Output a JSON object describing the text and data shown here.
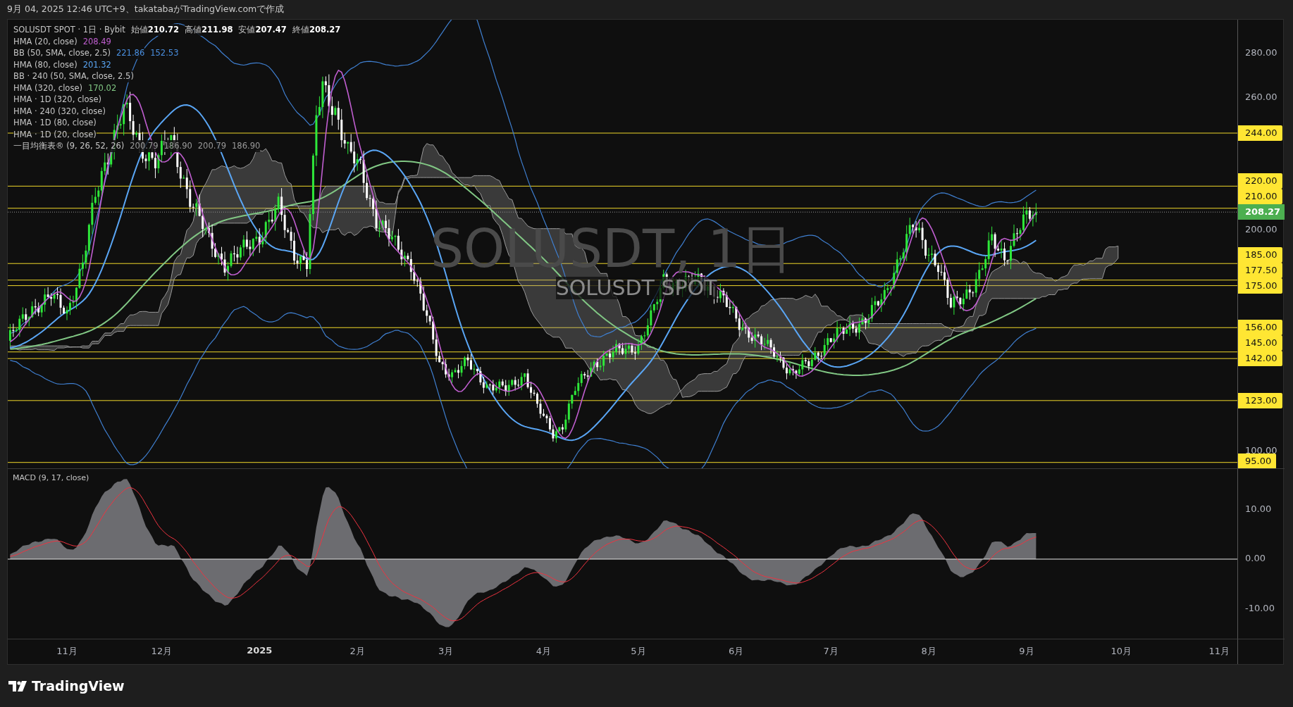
{
  "header": {
    "text": "9月 04, 2025 12:46 UTC+9、takatabaがTradingView.comで作成"
  },
  "legend": {
    "symbol": "SOLUSDT SPOT · 1日 · Bybit",
    "ohlc": [
      {
        "label": "始値",
        "value": "210.72"
      },
      {
        "label": "高値",
        "value": "211.98"
      },
      {
        "label": "安値",
        "value": "207.47"
      },
      {
        "label": "終値",
        "value": "208.27"
      }
    ],
    "indicators": [
      {
        "name": "HMA (20, close)",
        "values": [
          {
            "text": "208.49",
            "color": "#c05ed0"
          }
        ]
      },
      {
        "name": "BB (50, SMA, close, 2.5)",
        "values": [
          {
            "text": "221.86",
            "color": "#4a8fe0"
          },
          {
            "text": "152.53",
            "color": "#4a8fe0"
          }
        ]
      },
      {
        "name": "HMA (80, close)",
        "values": [
          {
            "text": "201.32",
            "color": "#5aa6f5"
          }
        ]
      },
      {
        "name": "BB · 240 (50, SMA, close, 2.5)"
      },
      {
        "name": "HMA (320, close)",
        "values": [
          {
            "text": "170.02",
            "color": "#81c784"
          }
        ]
      },
      {
        "name": "HMA · 1D (320, close)"
      },
      {
        "name": "HMA · 240 (320, close)"
      },
      {
        "name": "HMA · 1D (80, close)"
      },
      {
        "name": "HMA · 1D (20, close)"
      },
      {
        "name": "一目均衡表® (9, 26, 52, 26)",
        "values": [
          {
            "text": "200.79",
            "color": "#9a9a9a"
          },
          {
            "text": "186.90",
            "color": "#9a9a9a"
          },
          {
            "text": "200.79",
            "color": "#9a9a9a"
          },
          {
            "text": "186.90",
            "color": "#9a9a9a"
          }
        ]
      }
    ]
  },
  "watermark": {
    "title": "SOLUSDT, 1日",
    "subtitle": "SOLUSDT SPOT"
  },
  "price_axis": {
    "labels": [
      "280.00",
      "260.00",
      "200.00",
      "100.00"
    ]
  },
  "levels": [
    "244.00",
    "220.00",
    "210.00",
    "185.00",
    "177.50",
    "175.00",
    "156.00",
    "145.00",
    "142.00",
    "123.00",
    "95.00"
  ],
  "current_price": "208.27",
  "macd": {
    "title": "MACD (9, 17, close)",
    "axis_labels": [
      "10.00",
      "0.00",
      "-10.00"
    ]
  },
  "time_axis": {
    "labels": [
      {
        "text": "11月",
        "kind": "month"
      },
      {
        "text": "12月",
        "kind": "month"
      },
      {
        "text": "2025",
        "kind": "year"
      },
      {
        "text": "2月",
        "kind": "month"
      },
      {
        "text": "3月",
        "kind": "month"
      },
      {
        "text": "4月",
        "kind": "month"
      },
      {
        "text": "5月",
        "kind": "month"
      },
      {
        "text": "6月",
        "kind": "month"
      },
      {
        "text": "7月",
        "kind": "month"
      },
      {
        "text": "8月",
        "kind": "month"
      },
      {
        "text": "9月",
        "kind": "month"
      },
      {
        "text": "10月",
        "kind": "month"
      },
      {
        "text": "11月",
        "kind": "month"
      }
    ]
  },
  "footer": {
    "logo": "TradingView"
  }
}
